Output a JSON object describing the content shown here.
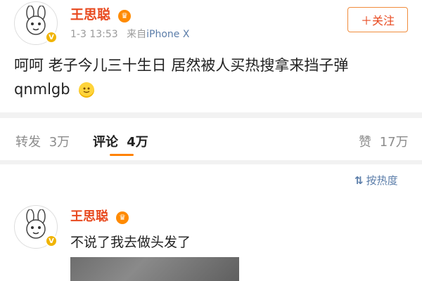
{
  "post": {
    "author": "王思聪",
    "time": "1-3 13:53",
    "source_prefix": "来自",
    "source": "iPhone X",
    "follow_label": "＋关注",
    "text_line1": "呵呵 老子今儿三十生日 居然被人买热搜拿来挡子弹",
    "text_line2": "qnmlgb"
  },
  "stats": {
    "repost_label": "转发",
    "repost_count": "3万",
    "comment_label": "评论",
    "comment_count": "4万",
    "like_label": "赞",
    "like_count": "17万"
  },
  "sort": {
    "label": "按热度"
  },
  "comment": {
    "author": "王思聪",
    "text": "不说了我去做头发了"
  },
  "colors": {
    "accent": "#ff8200",
    "name": "#e8491f",
    "link": "#5b7da9"
  }
}
